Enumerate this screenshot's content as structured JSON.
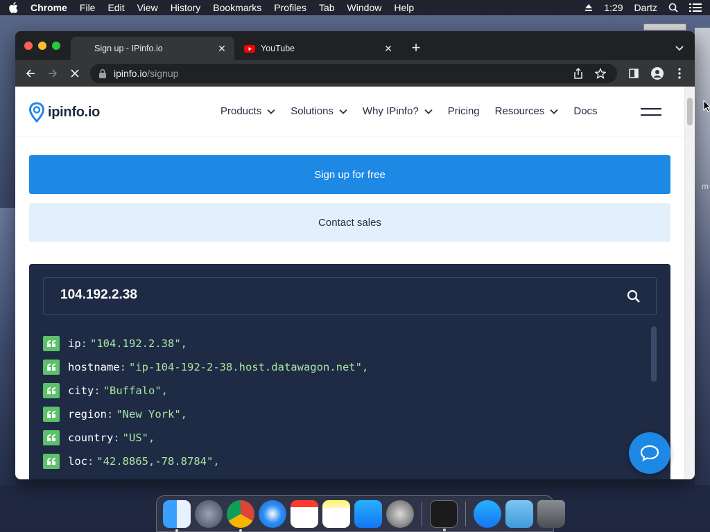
{
  "menubar": {
    "app": "Chrome",
    "items": [
      "File",
      "Edit",
      "View",
      "History",
      "Bookmarks",
      "Profiles",
      "Tab",
      "Window",
      "Help"
    ],
    "clock": "1:29",
    "user": "Dartz"
  },
  "desktop": {
    "edge_label": "m"
  },
  "browser": {
    "tabs": [
      {
        "title": "Sign up - IPinfo.io",
        "active": true
      },
      {
        "title": "YouTube",
        "active": false
      }
    ],
    "address": {
      "host": "ipinfo.io",
      "path": "/signup"
    }
  },
  "site": {
    "logo": "ipinfo.io",
    "nav": [
      "Products",
      "Solutions",
      "Why IPinfo?",
      "Pricing",
      "Resources",
      "Docs"
    ],
    "signup_button": "Sign up for free",
    "contact_button": "Contact sales",
    "ip_input_value": "104.192.2.38",
    "json": [
      {
        "key": "ip",
        "value": "\"104.192.2.38\","
      },
      {
        "key": "hostname",
        "value": "\"ip-104-192-2-38.host.datawagon.net\","
      },
      {
        "key": "city",
        "value": "\"Buffalo\","
      },
      {
        "key": "region",
        "value": "\"New York\","
      },
      {
        "key": "country",
        "value": "\"US\","
      },
      {
        "key": "loc",
        "value": "\"42.8865,-78.8784\","
      }
    ],
    "colors": {
      "primary": "#1e88e5",
      "panel": "#1f2a44",
      "badge": "#5cc16a",
      "value": "#a8e6a1"
    }
  }
}
